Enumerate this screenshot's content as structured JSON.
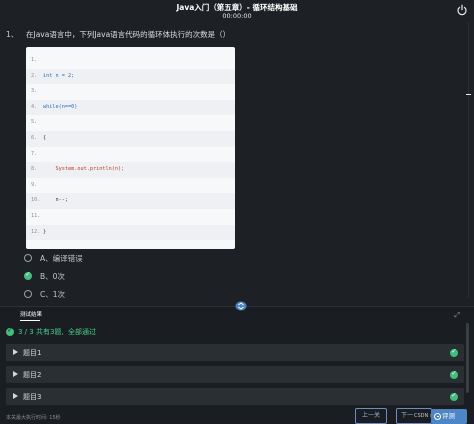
{
  "header": {
    "title": "Java入门（第五章）- 循环结构基础",
    "timer": "00:00:00"
  },
  "question": {
    "number": "1、",
    "text": "在Java语言中，下列Java语言代码的循环体执行的次数是（）",
    "code_lines": [
      {
        "num": "1.",
        "text": ""
      },
      {
        "num": "2.",
        "text": "int n = 2;"
      },
      {
        "num": "3.",
        "text": ""
      },
      {
        "num": "4.",
        "text": "while(n==0)"
      },
      {
        "num": "5.",
        "text": ""
      },
      {
        "num": "6.",
        "text": "{"
      },
      {
        "num": "7.",
        "text": ""
      },
      {
        "num": "8.",
        "text": "    System.out.println(n);"
      },
      {
        "num": "9.",
        "text": ""
      },
      {
        "num": "10.",
        "text": "    n--;"
      },
      {
        "num": "11.",
        "text": ""
      },
      {
        "num": "12.",
        "text": "}"
      }
    ],
    "options": [
      {
        "label": "A、编译错误",
        "checked": false
      },
      {
        "label": "B、0次",
        "checked": true
      },
      {
        "label": "C、1次",
        "checked": false
      }
    ]
  },
  "results": {
    "tab_label": "测试结果",
    "summary": "3 / 3 共有3题,",
    "status": "全部通过",
    "cases": [
      {
        "label": "题目1"
      },
      {
        "label": "题目2"
      },
      {
        "label": "题目3"
      }
    ]
  },
  "footer": {
    "max_time": "本关最大执行时间: 15秒",
    "prev_label": "上一关",
    "next_label": "下一",
    "watermark": "CSDN @",
    "eval_label": "评测"
  },
  "colors": {
    "accent_green": "#3ec07e",
    "button_blue": "#4d86c6",
    "background": "#1d2125"
  }
}
